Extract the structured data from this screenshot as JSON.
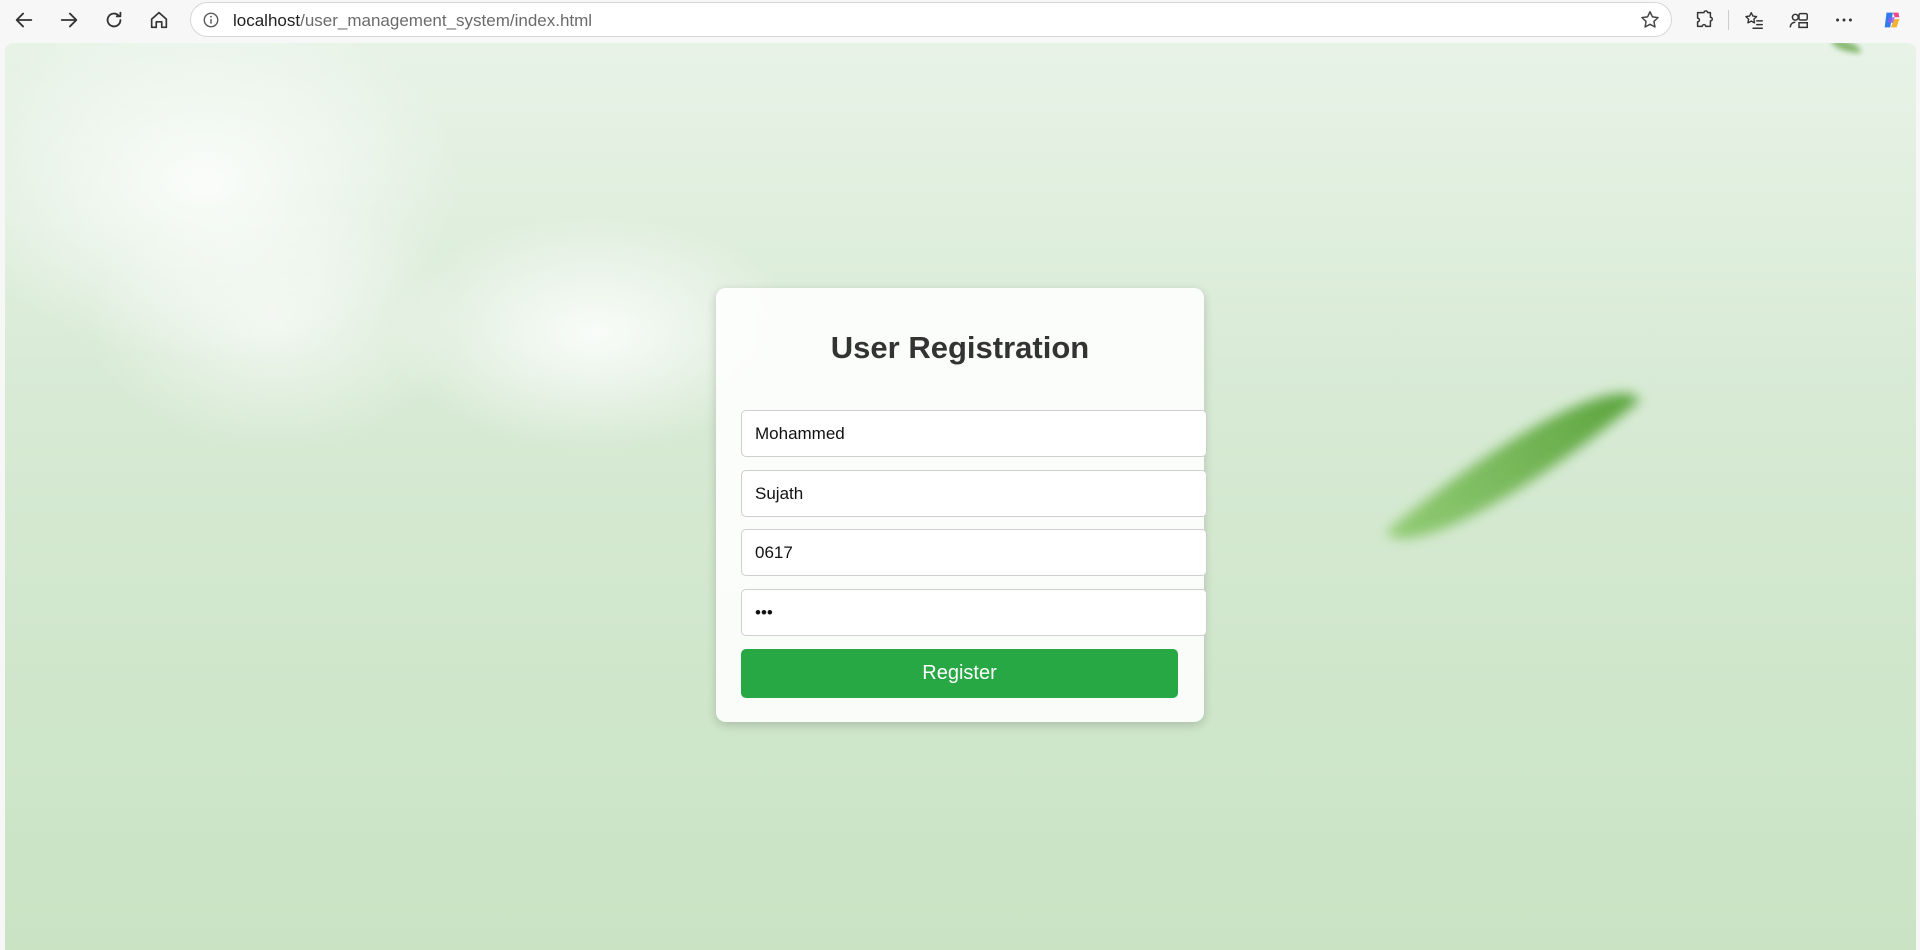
{
  "browser": {
    "url_host": "localhost",
    "url_path": "/user_management_system/index.html",
    "icons": {
      "back": "back-arrow-icon",
      "forward": "forward-arrow-icon",
      "refresh": "refresh-icon",
      "home": "home-icon",
      "site_info": "info-icon",
      "favorite": "star-icon",
      "extensions": "puzzle-icon",
      "favorites_list": "favorites-list-icon",
      "profile": "profile-icon",
      "more": "more-icon",
      "copilot": "copilot-icon"
    }
  },
  "form": {
    "title": "User Registration",
    "first_name_value": "Mohammed",
    "last_name_value": "Sujath",
    "id_value": "0617",
    "password_value": "abc",
    "submit_label": "Register"
  },
  "colors": {
    "accent": "#28a745",
    "background": "#d7ead4"
  }
}
